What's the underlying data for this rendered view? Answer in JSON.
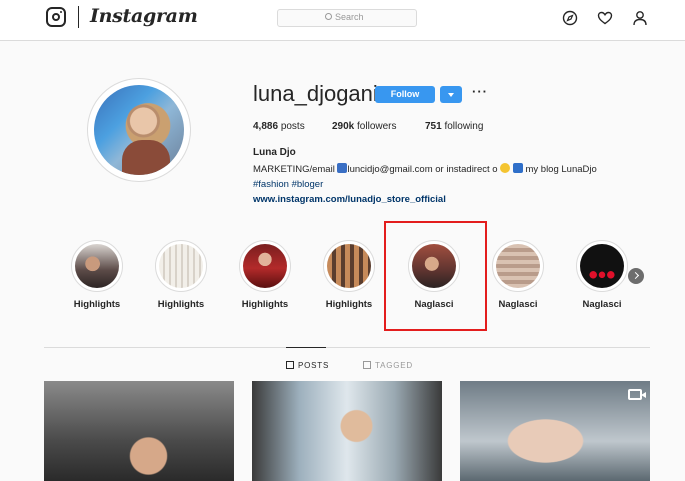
{
  "nav": {
    "brand": "Instagram",
    "search_placeholder": "Search"
  },
  "profile": {
    "username": "luna_djogani",
    "follow_label": "Follow",
    "stats": {
      "posts_count": "4,886",
      "posts_label": "posts",
      "followers_count": "290k",
      "followers_label": "followers",
      "following_count": "751",
      "following_label": "following"
    },
    "full_name": "Luna Djo",
    "bio_line1_a": "MARKETING/email",
    "bio_line1_b": "luncidjo@gmail.com or instadirect o",
    "bio_line1_c": "my blog LunaDjo",
    "hashtag1": "#fashion",
    "hashtag2": "#bloger",
    "website": "www.instagram.com/lunadjo_store_official"
  },
  "highlights": [
    {
      "label": "Highlights"
    },
    {
      "label": "Highlights"
    },
    {
      "label": "Highlights"
    },
    {
      "label": "Highlights"
    },
    {
      "label": "Naglasci"
    },
    {
      "label": "Naglasci"
    },
    {
      "label": "Naglasci"
    }
  ],
  "tabs": {
    "posts": "POSTS",
    "tagged": "TAGGED"
  },
  "colors": {
    "follow_blue": "#3897f0",
    "highlight_box": "#e31d1d",
    "link": "#003569"
  }
}
